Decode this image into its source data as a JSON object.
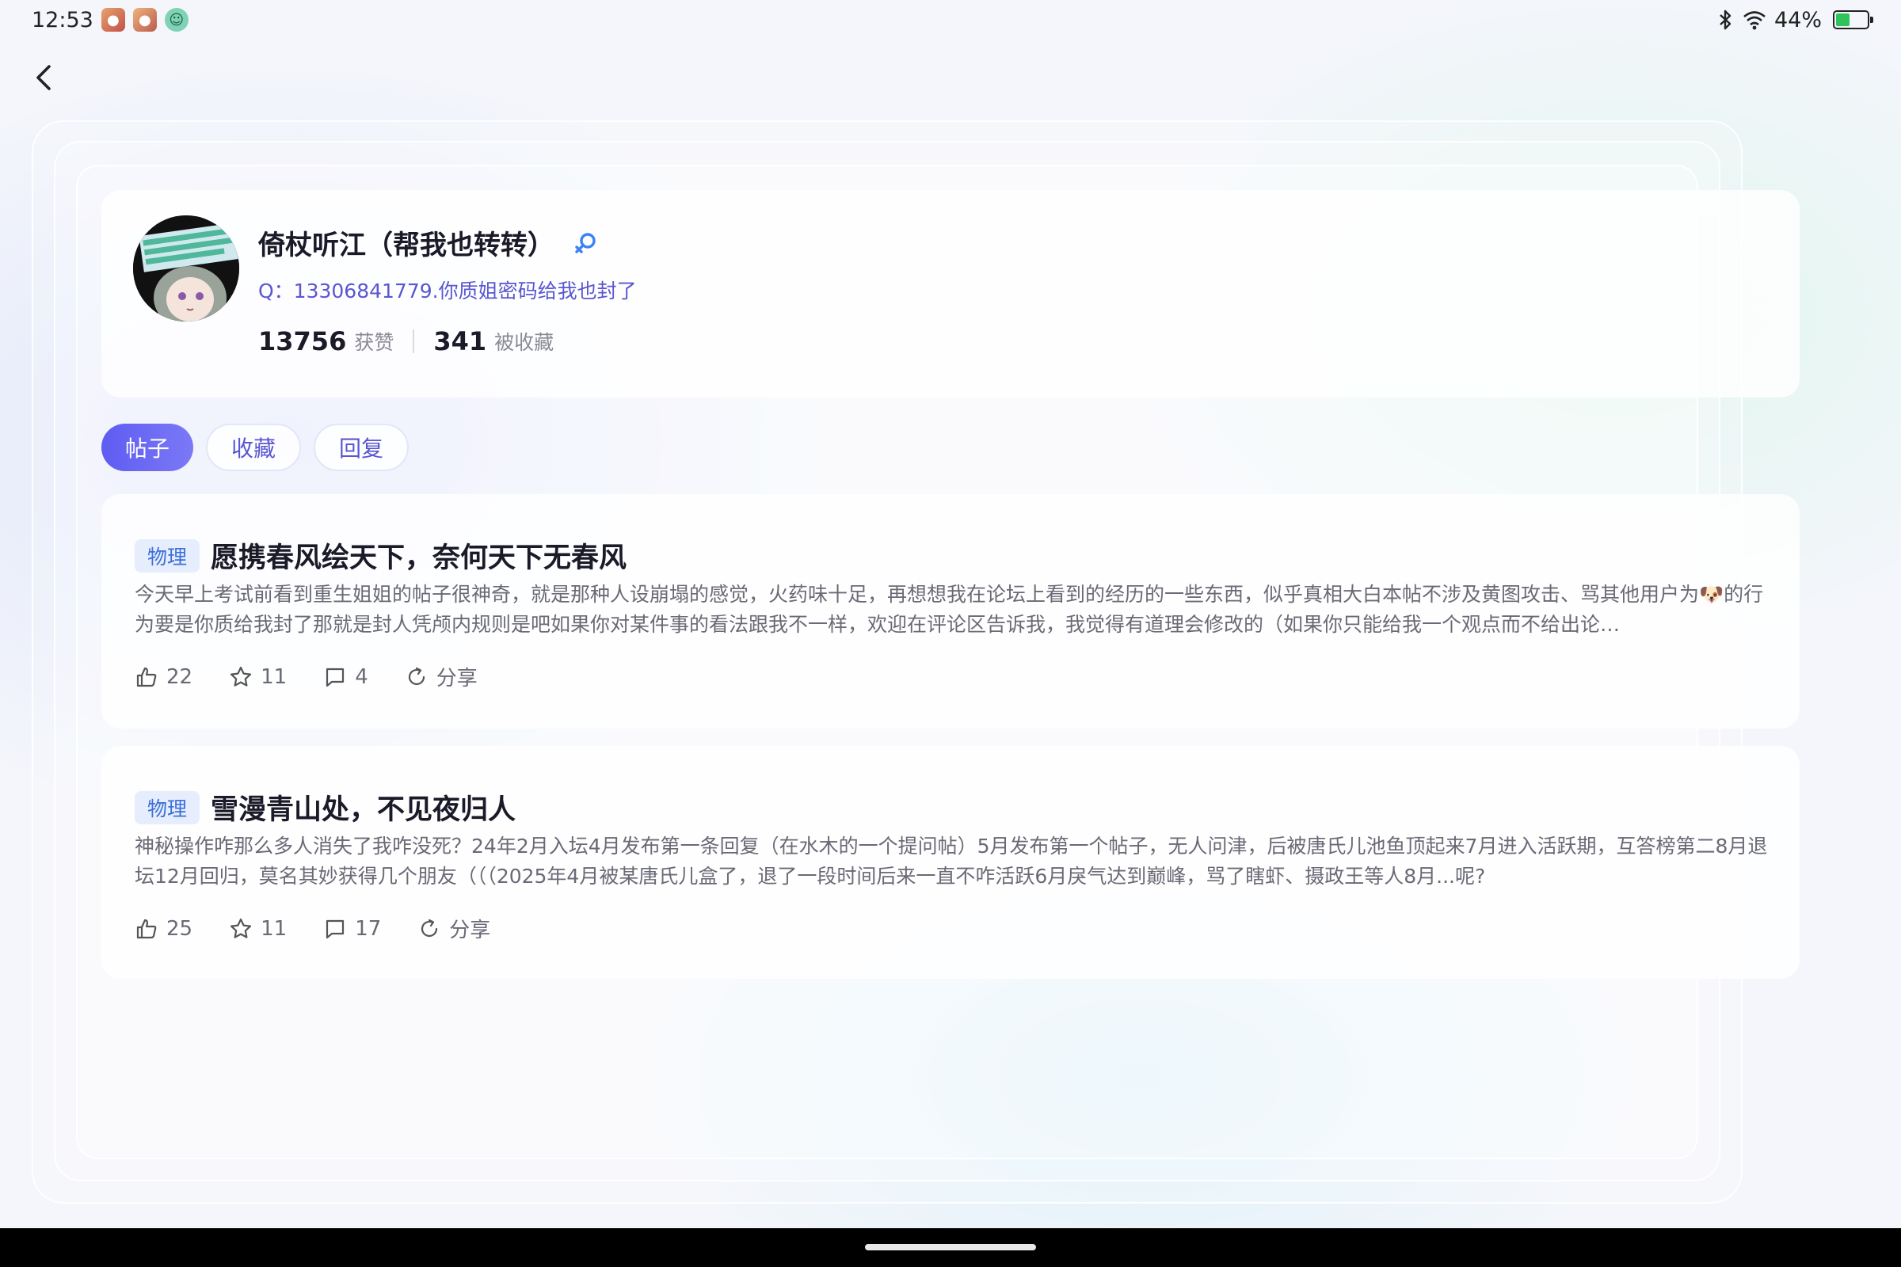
{
  "status_bar": {
    "time": "12:53",
    "battery": "44%",
    "battery_level": 0.44
  },
  "profile": {
    "username": "倚杖听江（帮我也转转）",
    "gender_icon": "female-icon",
    "bio": "Q：13306841779.你质姐密码给我也封了",
    "likes_count": "13756",
    "likes_label": "获赞",
    "favorites_count": "341",
    "favorites_label": "被收藏"
  },
  "tabs": [
    {
      "label": "帖子",
      "active": true
    },
    {
      "label": "收藏",
      "active": false
    },
    {
      "label": "回复",
      "active": false
    }
  ],
  "posts": [
    {
      "tag": "物理",
      "title": "愿携春风绘天下，奈何天下无春风",
      "excerpt": "今天早上考试前看到重生姐姐的帖子很神奇，就是那种人设崩塌的感觉，火药味十足，再想想我在论坛上看到的经历的一些东西，似乎真相大白本帖不涉及黄图攻击、骂其他用户为🐶的行为要是你质给我封了那就是封人凭颅内规则是吧如果你对某件事的看法跟我不一样，欢迎在评论区告诉我，我觉得有道理会修改的（如果你只能给我一个观点而不给出论…",
      "likes": "22",
      "favorites": "11",
      "comments": "4",
      "share_label": "分享"
    },
    {
      "tag": "物理",
      "title": "雪漫青山处，不见夜归人",
      "excerpt": "神秘操作咋那么多人消失了我咋没死？24年2月入坛4月发布第一条回复（在水木的一个提问帖）5月发布第一个帖子，无人问津，后被唐氏儿池鱼顶起来7月进入活跃期，互答榜第二8月退坛12月回归，莫名其妙获得几个朋友（（（2025年4月被某唐氏儿盒了，退了一段时间后来一直不咋活跃6月戾气达到巅峰，骂了瞎虾、摄政王等人8月...呢?",
      "likes": "25",
      "favorites": "11",
      "comments": "17",
      "share_label": "分享"
    }
  ]
}
